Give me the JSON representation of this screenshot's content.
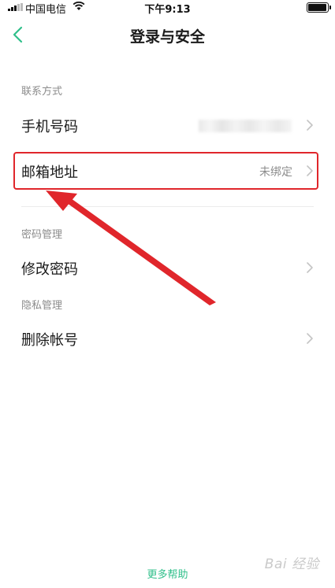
{
  "status_bar": {
    "carrier": "中国电信",
    "time": "下午9:13",
    "battery_level": 0.95
  },
  "header": {
    "title": "登录与安全",
    "back_icon": "chevron-left-icon"
  },
  "sections": {
    "contact": {
      "label": "联系方式",
      "phone_label": "手机号码",
      "email_label": "邮箱地址",
      "email_value": "未绑定"
    },
    "password": {
      "label": "密码管理",
      "change_label": "修改密码"
    },
    "privacy": {
      "label": "隐私管理",
      "delete_label": "删除帐号"
    }
  },
  "footer": {
    "more_help": "更多帮助",
    "watermark": "Bai 经验"
  },
  "colors": {
    "accent": "#2fbf8a",
    "annotation": "#e0262b"
  }
}
